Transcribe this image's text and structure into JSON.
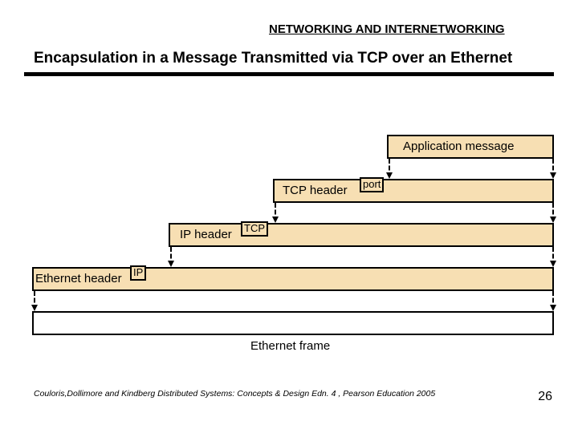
{
  "header": {
    "band": "NETWORKING AND INTERNETWORKING"
  },
  "title": "Encapsulation in a Message Transmitted via TCP over an Ethernet",
  "layers": {
    "app": {
      "label": "Application message"
    },
    "tcp": {
      "label": "TCP header",
      "tag": "port"
    },
    "ip": {
      "label": "IP header",
      "tag": "TCP"
    },
    "eth": {
      "label": "Ethernet header",
      "tag": "IP"
    },
    "frame": {
      "label": "Ethernet frame"
    }
  },
  "footer": {
    "citation": "Couloris,Dollimore and Kindberg  Distributed Systems: Concepts & Design  Edn. 4 , Pearson Education 2005",
    "page": "26"
  }
}
